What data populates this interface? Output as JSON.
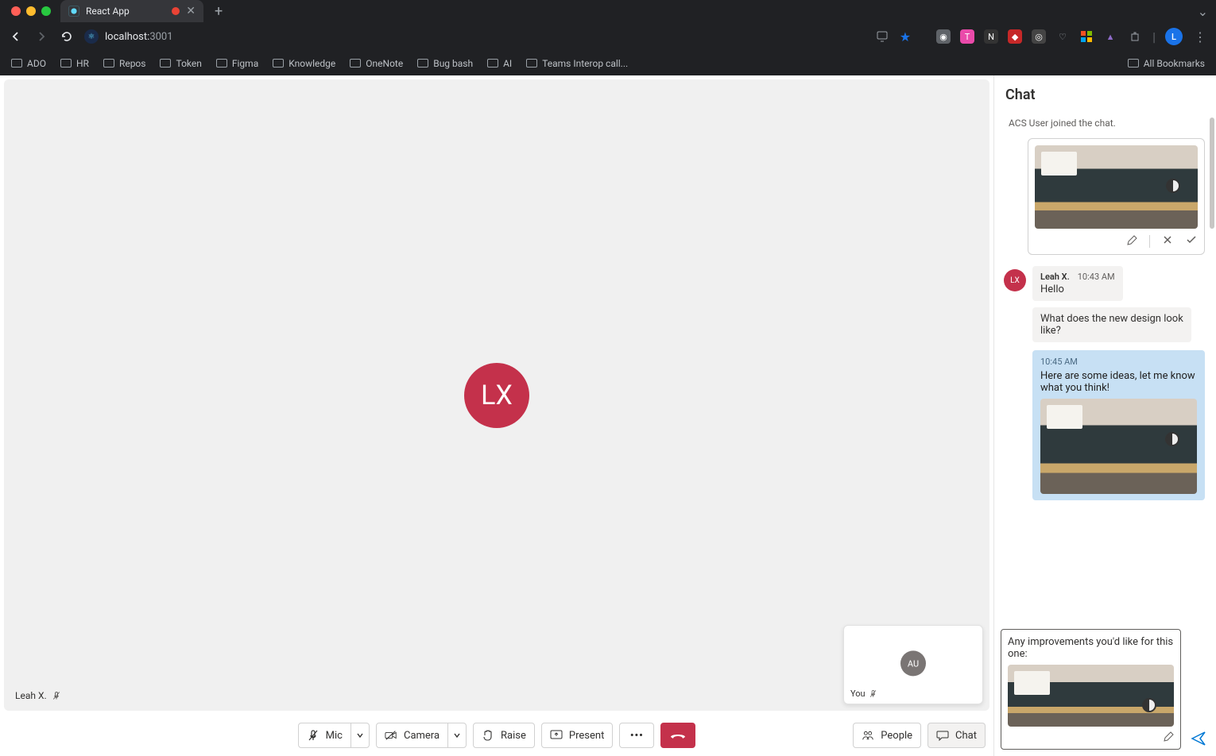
{
  "browser": {
    "tab_title": "React App",
    "url_host": "localhost:",
    "url_port": "3001",
    "bookmarks": [
      "ADO",
      "HR",
      "Repos",
      "Token",
      "Figma",
      "Knowledge",
      "OneNote",
      "Bug bash",
      "AI",
      "Teams Interop call..."
    ],
    "all_bookmarks": "All Bookmarks",
    "profile_initial": "L"
  },
  "stage": {
    "main_avatar": "LX",
    "main_name": "Leah X.",
    "pip_avatar": "AU",
    "pip_name": "You"
  },
  "controls": {
    "mic": "Mic",
    "camera": "Camera",
    "raise": "Raise",
    "present": "Present",
    "people": "People",
    "chat": "Chat"
  },
  "chat": {
    "header": "Chat",
    "system_msg": "ACS User joined the chat.",
    "leah_avatar": "LX",
    "msg1_name": "Leah X.",
    "msg1_time": "10:43 AM",
    "msg1_text": "Hello",
    "msg2_text": "What does the new design look like?",
    "msg3_time": "10:45 AM",
    "msg3_text": "Here are some ideas, let me know what you think!",
    "compose_text": "Any improvements you'd like for this one:"
  }
}
